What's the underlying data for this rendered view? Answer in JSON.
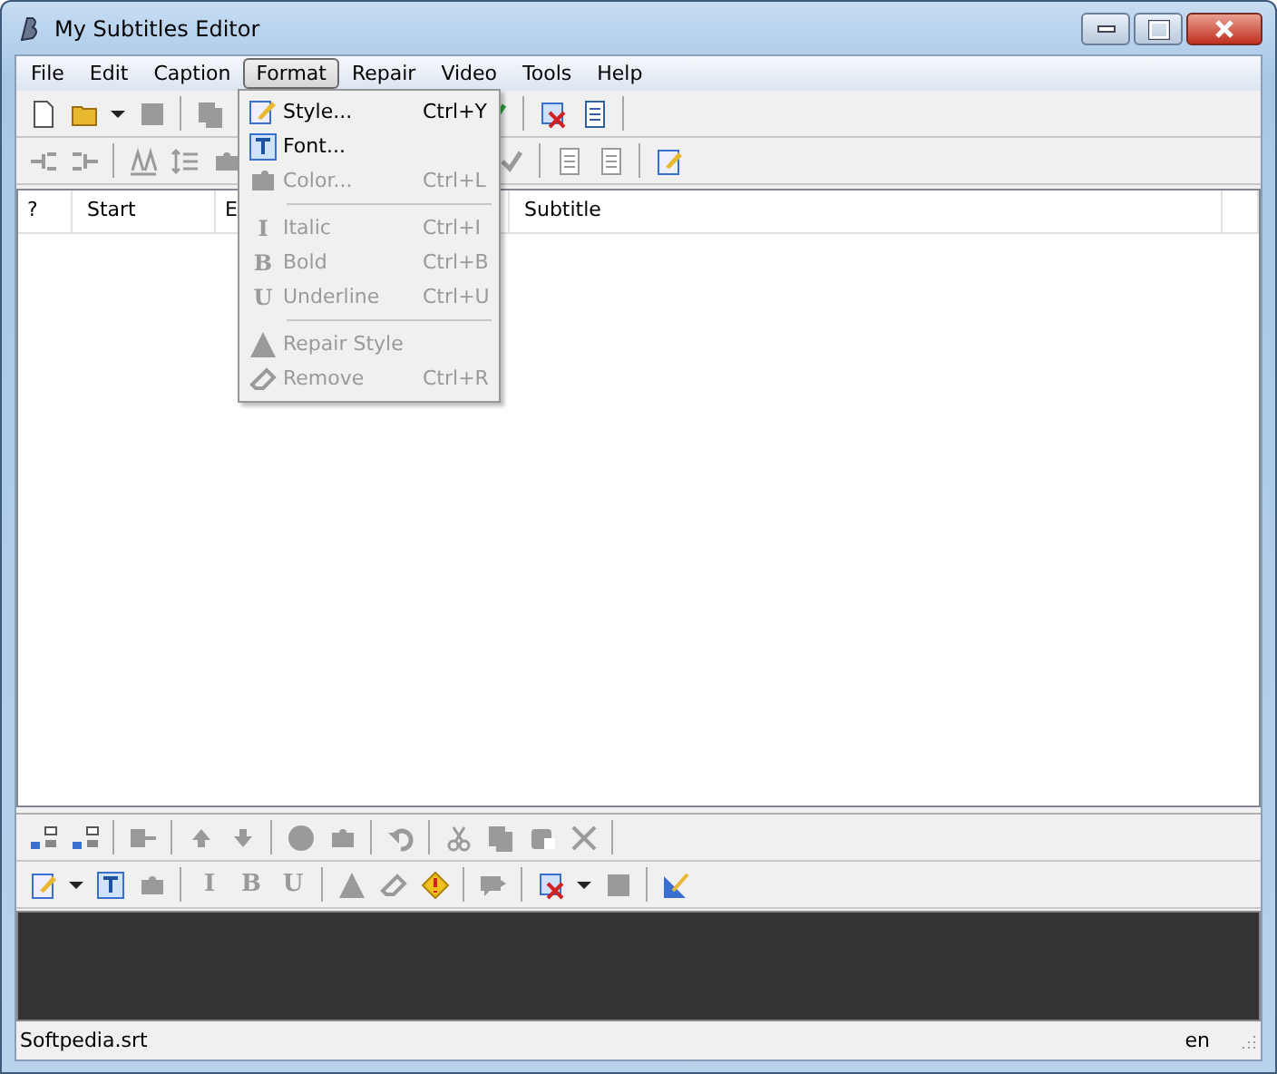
{
  "window": {
    "title": "My Subtitles Editor"
  },
  "menu_bar": [
    {
      "label": "File",
      "selected": false
    },
    {
      "label": "Edit",
      "selected": false
    },
    {
      "label": "Caption",
      "selected": false
    },
    {
      "label": "Format",
      "selected": true
    },
    {
      "label": "Repair",
      "selected": false
    },
    {
      "label": "Video",
      "selected": false
    },
    {
      "label": "Tools",
      "selected": false
    },
    {
      "label": "Help",
      "selected": false
    }
  ],
  "format_menu": [
    {
      "kind": "item",
      "label": "Style...",
      "shortcut": "Ctrl+Y",
      "disabled": false
    },
    {
      "kind": "item",
      "label": "Font...",
      "disabled": false
    },
    {
      "kind": "item",
      "label": "Color...",
      "shortcut": "Ctrl+L",
      "disabled": true
    },
    {
      "kind": "separator"
    },
    {
      "kind": "item",
      "glyph": "I",
      "label": "Italic",
      "shortcut": "Ctrl+I",
      "disabled": true
    },
    {
      "kind": "item",
      "glyph": "B",
      "label": "Bold",
      "shortcut": "Ctrl+B",
      "disabled": true
    },
    {
      "kind": "item",
      "glyph": "U",
      "label": "Underline",
      "shortcut": "Ctrl+U",
      "disabled": true
    },
    {
      "kind": "separator"
    },
    {
      "kind": "item",
      "label": "Repair Style",
      "disabled": true
    },
    {
      "kind": "item",
      "label": "Remove",
      "shortcut": "Ctrl+R",
      "disabled": true
    }
  ],
  "toolbars": [
    [
      {
        "kind": "button",
        "disabled": false
      },
      {
        "kind": "button",
        "disabled": false
      },
      {
        "kind": "dropdown",
        "disabled": false
      },
      {
        "kind": "button",
        "disabled": true
      },
      {
        "kind": "separator"
      },
      {
        "kind": "button",
        "disabled": true
      },
      {
        "kind": "spacer"
      },
      {
        "kind": "button",
        "disabled": false
      },
      {
        "kind": "separator"
      },
      {
        "kind": "button",
        "disabled": false
      },
      {
        "kind": "button",
        "disabled": false
      },
      {
        "kind": "separator"
      }
    ],
    [
      {
        "kind": "button",
        "disabled": true
      },
      {
        "kind": "button",
        "disabled": true
      },
      {
        "kind": "separator"
      },
      {
        "kind": "button",
        "disabled": true
      },
      {
        "kind": "button",
        "disabled": true
      },
      {
        "kind": "button",
        "disabled": true
      },
      {
        "kind": "spacer"
      },
      {
        "kind": "button",
        "disabled": true
      },
      {
        "kind": "separator"
      },
      {
        "kind": "button",
        "disabled": true
      },
      {
        "kind": "button",
        "disabled": true
      },
      {
        "kind": "separator"
      },
      {
        "kind": "button",
        "disabled": false
      }
    ],
    [
      {
        "kind": "button",
        "disabled": false
      },
      {
        "kind": "button",
        "disabled": false
      },
      {
        "kind": "separator"
      },
      {
        "kind": "button",
        "disabled": true
      },
      {
        "kind": "separator"
      },
      {
        "kind": "button",
        "disabled": true
      },
      {
        "kind": "button",
        "disabled": true
      },
      {
        "kind": "separator"
      },
      {
        "kind": "button",
        "disabled": true
      },
      {
        "kind": "button",
        "disabled": true
      },
      {
        "kind": "separator"
      },
      {
        "kind": "button",
        "disabled": true
      },
      {
        "kind": "separator"
      },
      {
        "kind": "button",
        "disabled": true
      },
      {
        "kind": "button",
        "disabled": true
      },
      {
        "kind": "button",
        "disabled": true
      },
      {
        "kind": "button",
        "disabled": true
      },
      {
        "kind": "separator"
      }
    ],
    [
      {
        "kind": "button",
        "disabled": false
      },
      {
        "kind": "dropdown",
        "disabled": false
      },
      {
        "kind": "button",
        "disabled": false
      },
      {
        "kind": "button",
        "disabled": true
      },
      {
        "kind": "separator"
      },
      {
        "kind": "glyph",
        "text": "I",
        "disabled": true
      },
      {
        "kind": "glyph",
        "text": "B",
        "disabled": true
      },
      {
        "kind": "glyph",
        "text": "U",
        "disabled": true
      },
      {
        "kind": "separator"
      },
      {
        "kind": "button",
        "disabled": true
      },
      {
        "kind": "button",
        "disabled": true
      },
      {
        "kind": "button",
        "disabled": false
      },
      {
        "kind": "separator"
      },
      {
        "kind": "button",
        "disabled": true
      },
      {
        "kind": "separator"
      },
      {
        "kind": "button",
        "disabled": false
      },
      {
        "kind": "dropdown",
        "disabled": false
      },
      {
        "kind": "button",
        "disabled": true
      },
      {
        "kind": "separator"
      },
      {
        "kind": "button",
        "disabled": false
      }
    ]
  ],
  "table": {
    "columns": [
      "?",
      "Start",
      "E",
      "",
      "Subtitle",
      ""
    ]
  },
  "status_bar": {
    "file": "Softpedia.srt",
    "language": "en"
  }
}
